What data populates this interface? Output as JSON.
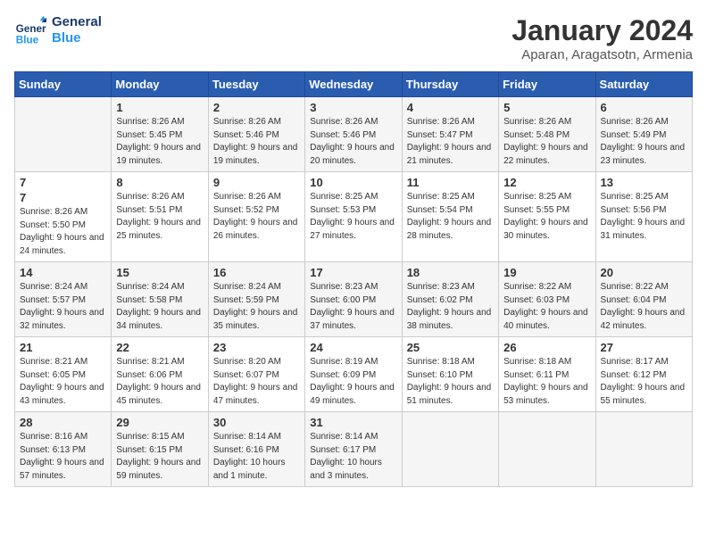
{
  "logo": {
    "line1": "General",
    "line2": "Blue"
  },
  "title": "January 2024",
  "subtitle": "Aparan, Aragatsotn, Armenia",
  "weekdays": [
    "Sunday",
    "Monday",
    "Tuesday",
    "Wednesday",
    "Thursday",
    "Friday",
    "Saturday"
  ],
  "weeks": [
    [
      {
        "day": "",
        "info": ""
      },
      {
        "day": "1",
        "info": "Sunrise: 8:26 AM\nSunset: 5:45 PM\nDaylight: 9 hours\nand 19 minutes."
      },
      {
        "day": "2",
        "info": "Sunrise: 8:26 AM\nSunset: 5:46 PM\nDaylight: 9 hours\nand 19 minutes."
      },
      {
        "day": "3",
        "info": "Sunrise: 8:26 AM\nSunset: 5:46 PM\nDaylight: 9 hours\nand 20 minutes."
      },
      {
        "day": "4",
        "info": "Sunrise: 8:26 AM\nSunset: 5:47 PM\nDaylight: 9 hours\nand 21 minutes."
      },
      {
        "day": "5",
        "info": "Sunrise: 8:26 AM\nSunset: 5:48 PM\nDaylight: 9 hours\nand 22 minutes."
      },
      {
        "day": "6",
        "info": "Sunrise: 8:26 AM\nSunset: 5:49 PM\nDaylight: 9 hours\nand 23 minutes."
      }
    ],
    [
      {
        "day": "7",
        "info": ""
      },
      {
        "day": "8",
        "info": "Sunrise: 8:26 AM\nSunset: 5:51 PM\nDaylight: 9 hours\nand 25 minutes."
      },
      {
        "day": "9",
        "info": "Sunrise: 8:26 AM\nSunset: 5:52 PM\nDaylight: 9 hours\nand 26 minutes."
      },
      {
        "day": "10",
        "info": "Sunrise: 8:25 AM\nSunset: 5:53 PM\nDaylight: 9 hours\nand 27 minutes."
      },
      {
        "day": "11",
        "info": "Sunrise: 8:25 AM\nSunset: 5:54 PM\nDaylight: 9 hours\nand 28 minutes."
      },
      {
        "day": "12",
        "info": "Sunrise: 8:25 AM\nSunset: 5:55 PM\nDaylight: 9 hours\nand 30 minutes."
      },
      {
        "day": "13",
        "info": "Sunrise: 8:25 AM\nSunset: 5:56 PM\nDaylight: 9 hours\nand 31 minutes."
      }
    ],
    [
      {
        "day": "14",
        "info": "Sunrise: 8:24 AM\nSunset: 5:57 PM\nDaylight: 9 hours\nand 32 minutes."
      },
      {
        "day": "15",
        "info": "Sunrise: 8:24 AM\nSunset: 5:58 PM\nDaylight: 9 hours\nand 34 minutes."
      },
      {
        "day": "16",
        "info": "Sunrise: 8:24 AM\nSunset: 5:59 PM\nDaylight: 9 hours\nand 35 minutes."
      },
      {
        "day": "17",
        "info": "Sunrise: 8:23 AM\nSunset: 6:00 PM\nDaylight: 9 hours\nand 37 minutes."
      },
      {
        "day": "18",
        "info": "Sunrise: 8:23 AM\nSunset: 6:02 PM\nDaylight: 9 hours\nand 38 minutes."
      },
      {
        "day": "19",
        "info": "Sunrise: 8:22 AM\nSunset: 6:03 PM\nDaylight: 9 hours\nand 40 minutes."
      },
      {
        "day": "20",
        "info": "Sunrise: 8:22 AM\nSunset: 6:04 PM\nDaylight: 9 hours\nand 42 minutes."
      }
    ],
    [
      {
        "day": "21",
        "info": "Sunrise: 8:21 AM\nSunset: 6:05 PM\nDaylight: 9 hours\nand 43 minutes."
      },
      {
        "day": "22",
        "info": "Sunrise: 8:21 AM\nSunset: 6:06 PM\nDaylight: 9 hours\nand 45 minutes."
      },
      {
        "day": "23",
        "info": "Sunrise: 8:20 AM\nSunset: 6:07 PM\nDaylight: 9 hours\nand 47 minutes."
      },
      {
        "day": "24",
        "info": "Sunrise: 8:19 AM\nSunset: 6:09 PM\nDaylight: 9 hours\nand 49 minutes."
      },
      {
        "day": "25",
        "info": "Sunrise: 8:18 AM\nSunset: 6:10 PM\nDaylight: 9 hours\nand 51 minutes."
      },
      {
        "day": "26",
        "info": "Sunrise: 8:18 AM\nSunset: 6:11 PM\nDaylight: 9 hours\nand 53 minutes."
      },
      {
        "day": "27",
        "info": "Sunrise: 8:17 AM\nSunset: 6:12 PM\nDaylight: 9 hours\nand 55 minutes."
      }
    ],
    [
      {
        "day": "28",
        "info": "Sunrise: 8:16 AM\nSunset: 6:13 PM\nDaylight: 9 hours\nand 57 minutes."
      },
      {
        "day": "29",
        "info": "Sunrise: 8:15 AM\nSunset: 6:15 PM\nDaylight: 9 hours\nand 59 minutes."
      },
      {
        "day": "30",
        "info": "Sunrise: 8:14 AM\nSunset: 6:16 PM\nDaylight: 10 hours\nand 1 minute."
      },
      {
        "day": "31",
        "info": "Sunrise: 8:14 AM\nSunset: 6:17 PM\nDaylight: 10 hours\nand 3 minutes."
      },
      {
        "day": "",
        "info": ""
      },
      {
        "day": "",
        "info": ""
      },
      {
        "day": "",
        "info": ""
      }
    ]
  ]
}
